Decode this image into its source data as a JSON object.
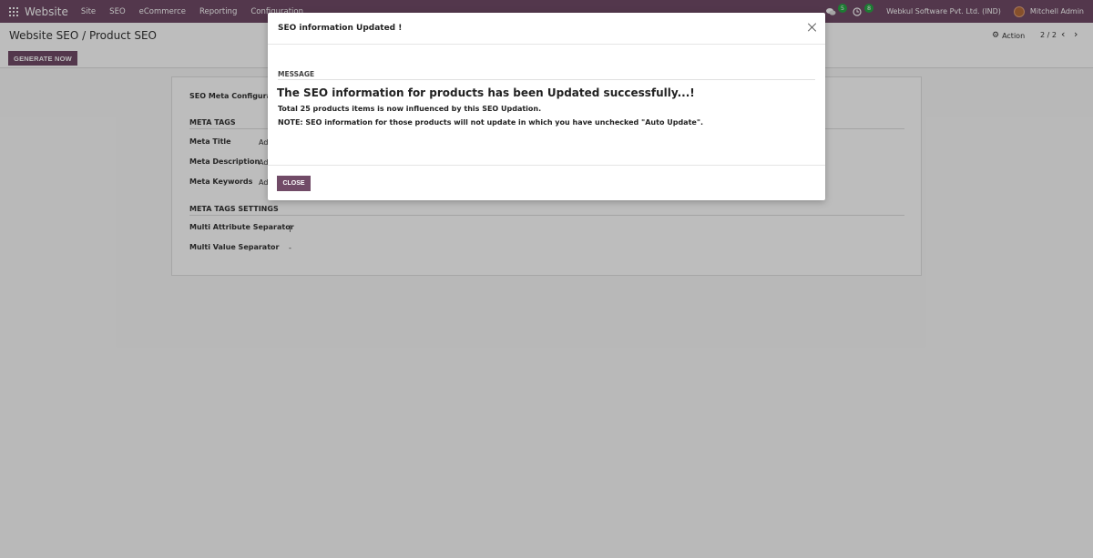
{
  "navbar": {
    "brand": "Website",
    "menu": [
      "Site",
      "SEO",
      "eCommerce",
      "Reporting",
      "Configuration"
    ],
    "messages_count": "5",
    "activities_count": "8",
    "company": "Webkul Software Pvt. Ltd. (IND)",
    "user": "Mitchell Admin"
  },
  "control_panel": {
    "breadcrumb": "Website SEO / Product SEO",
    "generate_label": "GENERATE NOW",
    "action_label": "Action",
    "pager": "2 / 2"
  },
  "form": {
    "seo_meta_config_label": "SEO Meta Configuration",
    "meta_tags_group": "META TAGS",
    "meta_title_label": "Meta Title",
    "meta_title_value": "Ad",
    "meta_description_label": "Meta Description",
    "meta_description_value": "Ad",
    "meta_keywords_label": "Meta Keywords",
    "meta_keywords_value": "Ad",
    "meta_tags_settings_group": "META TAGS SETTINGS",
    "multi_attr_sep_label": "Multi Attribute Separator",
    "multi_attr_sep_value": "|",
    "multi_value_sep_label": "Multi Value Separator",
    "multi_value_sep_value": "-"
  },
  "modal": {
    "title": "SEO information Updated !",
    "message_label": "MESSAGE",
    "headline": "The SEO information for products has been Updated successfully...!",
    "line1": "Total 25 products items is now influenced by this SEO Updation.",
    "line2": "NOTE: SEO information for those products will not update in which you have unchecked \"Auto Update\".",
    "close_label": "CLOSE"
  },
  "colors": {
    "brand": "#714b67",
    "badge": "#28a745"
  }
}
